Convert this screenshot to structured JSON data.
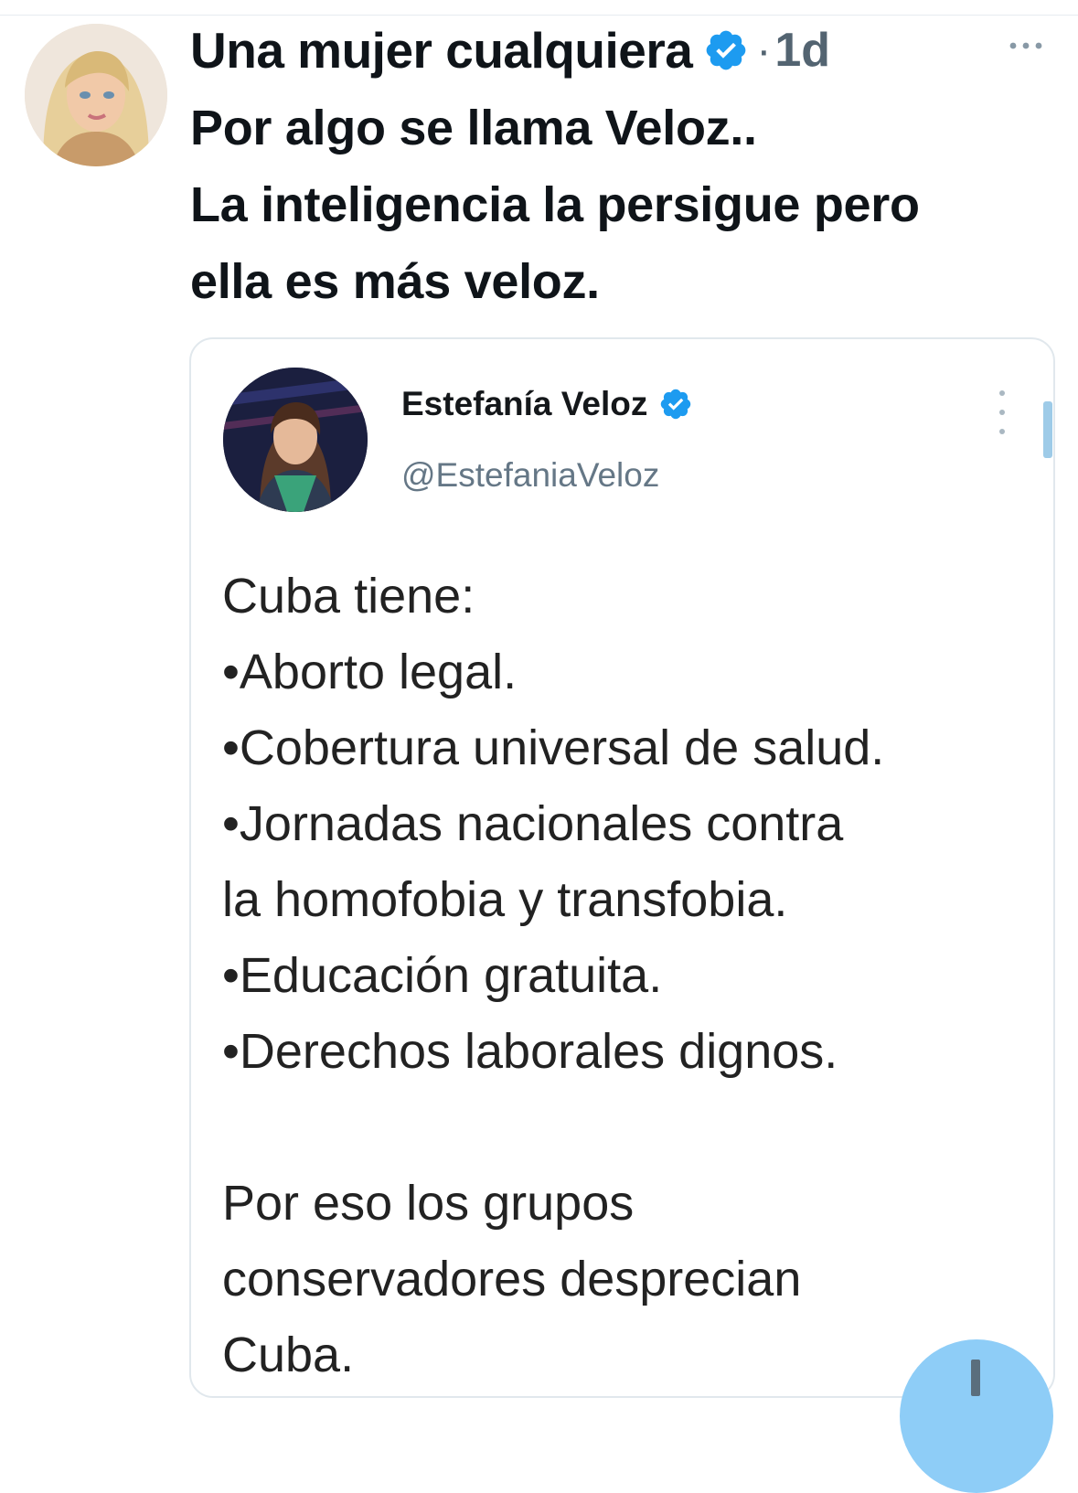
{
  "tweet": {
    "author_name": "Una mujer cualquiera",
    "separator": "·",
    "time_ago": "1d",
    "text": "Por algo se llama Veloz..\nLa inteligencia la persigue pero\nella es más veloz."
  },
  "quoted": {
    "author_name": "Estefanía Veloz",
    "handle": "@EstefaniaVeloz",
    "body": "Cuba tiene:\n•Aborto legal.\n•Cobertura universal de salud.\n•Jornadas nacionales contra\nla homofobia y transfobia.\n•Educación gratuita.\n•Derechos laborales dignos.\n\nPor eso los grupos\nconservadores desprecian\nCuba."
  },
  "icons": {
    "verified": "verified-badge-icon",
    "more": "more-horizontal-icon",
    "quoted_more": "more-vertical-icon",
    "compose": "compose-icon"
  },
  "colors": {
    "verified_blue": "#1d9bf0",
    "secondary_text": "#536471",
    "fab": "#8ecdf7"
  }
}
